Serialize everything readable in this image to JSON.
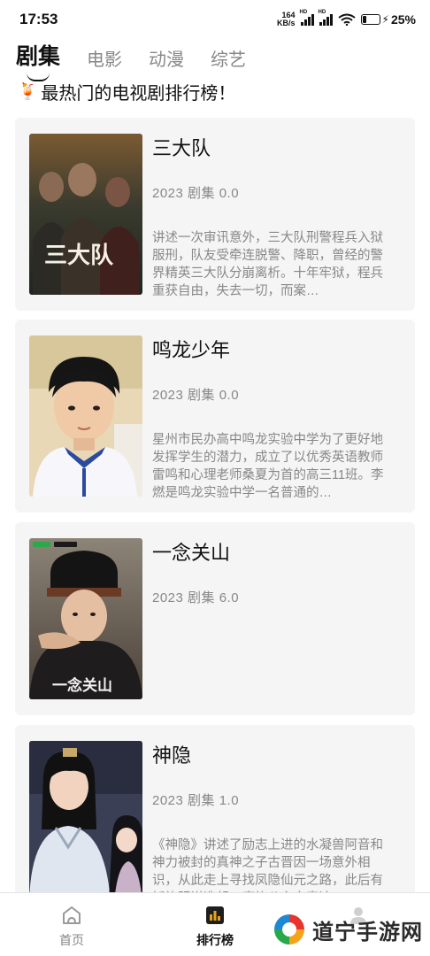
{
  "status_bar": {
    "time": "17:53",
    "net_speed_value": "164",
    "net_speed_unit": "KB/s",
    "sim1_label": "HD",
    "sim2_label": "HD",
    "battery_level_pct": 25,
    "battery_text": "25%"
  },
  "tabs": [
    {
      "label": "剧集",
      "active": true
    },
    {
      "label": "电影",
      "active": false
    },
    {
      "label": "动漫",
      "active": false
    },
    {
      "label": "综艺",
      "active": false
    }
  ],
  "headline": {
    "icon": "cocktail-icon",
    "text": "最热门的电视剧排行榜！"
  },
  "shows": [
    {
      "title": "三大队",
      "meta": "2023 剧集 0.0",
      "description": "讲述一次审讯意外，三大队刑警程兵入狱服刑，队友受牵连脱警、降职，曾经的警界精英三大队分崩离析。十年牢狱，程兵重获自由，失去一切，而案…",
      "poster_text": "三大队"
    },
    {
      "title": "鸣龙少年",
      "meta": "2023 剧集 0.0",
      "description": "星州市民办高中鸣龙实验中学为了更好地发挥学生的潜力，成立了以优秀英语教师雷鸣和心理老师桑夏为首的高三11班。李燃是鸣龙实验中学一名普通的…",
      "poster_text": ""
    },
    {
      "title": "一念关山",
      "meta": "2023 剧集 6.0",
      "description": "",
      "poster_text": "一念关山"
    },
    {
      "title": "神隐",
      "meta": "2023 剧集 1.0",
      "description": "《神隐》讲述了励志上进的水凝兽阿音和神力被封的真神之子古晋因一场意外相识，从此走上寻找凤隐仙元之路，此后有妖族阴谋迭起，魔族公主安泰达…",
      "poster_text": ""
    }
  ],
  "bottom_nav": [
    {
      "label": "首页",
      "icon": "home-icon",
      "active": false
    },
    {
      "label": "排行榜",
      "icon": "ranking-icon",
      "active": true
    },
    {
      "label": "",
      "icon": "profile-icon",
      "active": false
    }
  ],
  "watermark": {
    "text": "道宁手游网"
  },
  "colors": {
    "card_bg": "#f5f5f5",
    "text_primary": "#111111",
    "text_secondary": "#888888",
    "ranking_icon_accent": "#e8a21a"
  }
}
